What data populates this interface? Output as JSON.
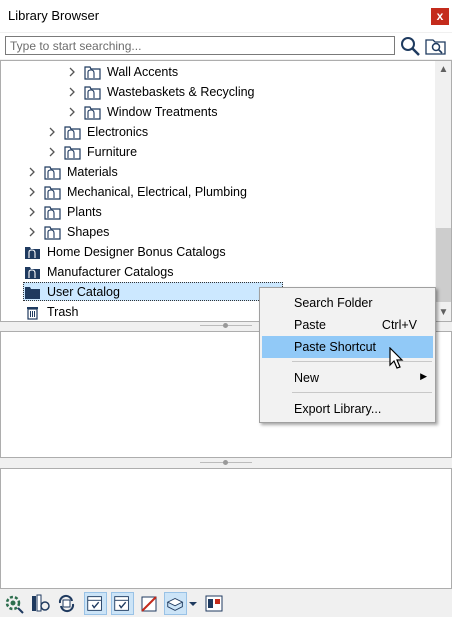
{
  "window": {
    "title": "Library Browser",
    "close_label": "x"
  },
  "search": {
    "placeholder": "Type to start searching...",
    "value": ""
  },
  "tree": [
    {
      "label": "Wall Accents",
      "expandable": true
    },
    {
      "label": "Wastebaskets & Recycling",
      "expandable": true
    },
    {
      "label": "Window Treatments",
      "expandable": true
    },
    {
      "label": "Electronics",
      "expandable": true
    },
    {
      "label": "Furniture",
      "expandable": true
    },
    {
      "label": "Materials",
      "expandable": true
    },
    {
      "label": "Mechanical, Electrical, Plumbing",
      "expandable": true
    },
    {
      "label": "Plants",
      "expandable": true
    },
    {
      "label": "Shapes",
      "expandable": true
    },
    {
      "label": "Home Designer Bonus Catalogs",
      "expandable": false
    },
    {
      "label": "Manufacturer Catalogs",
      "expandable": false
    },
    {
      "label": "User Catalog",
      "expandable": false,
      "selected": true
    },
    {
      "label": "Trash",
      "expandable": false
    }
  ],
  "context_menu": {
    "items": [
      {
        "label": "Search Folder",
        "shortcut": ""
      },
      {
        "label": "Paste",
        "shortcut": "Ctrl+V"
      },
      {
        "label": "Paste Shortcut",
        "shortcut": "",
        "highlighted": true
      },
      {
        "label": "New",
        "shortcut": "",
        "submenu": true
      },
      {
        "label": "Export Library...",
        "shortcut": ""
      }
    ]
  },
  "colors": {
    "selection": "#cce8ff",
    "menu_highlight": "#91c9f7",
    "close_button": "#c42b1c",
    "folder_icon": "#1f3a5f"
  },
  "toolbar_icons": [
    "library-settings-icon",
    "library-catalogs-icon",
    "refresh-library-icon",
    "show-filter-icon",
    "show-checked-icon",
    "material-icon",
    "object-dropdown-icon",
    "preview-icon"
  ]
}
